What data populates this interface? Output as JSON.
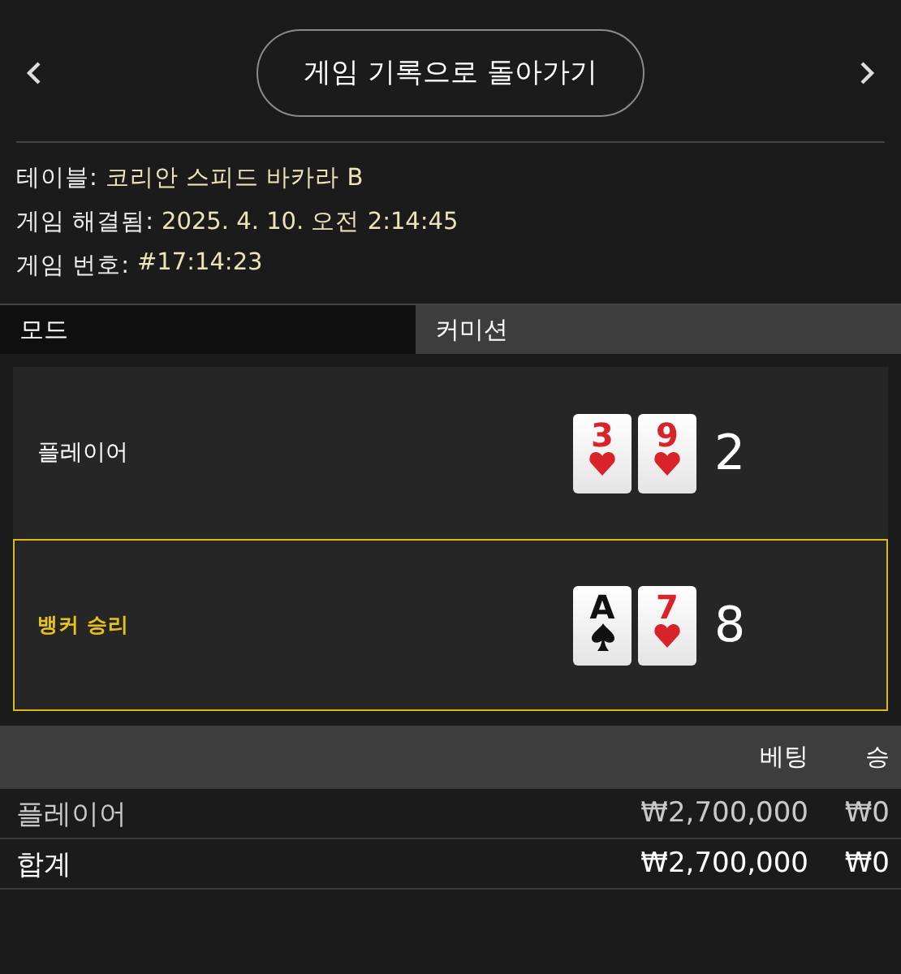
{
  "header": {
    "back_button": "게임 기록으로 돌아가기"
  },
  "info": [
    {
      "label": "테이블:",
      "value": "코리안 스피드 바카라 B"
    },
    {
      "label": "게임 해결됨:",
      "value": "2025. 4. 10. 오전 2:14:45"
    },
    {
      "label": "게임 번호:",
      "value": "#17:14:23"
    }
  ],
  "mode_row": {
    "label": "모드",
    "value": "커미션"
  },
  "hands": [
    {
      "label": "플레이어",
      "winner": false,
      "cards": [
        {
          "rank": "3",
          "kind": "heart"
        },
        {
          "rank": "9",
          "kind": "heart"
        }
      ],
      "score": "2"
    },
    {
      "label": "뱅커 승리",
      "winner": true,
      "cards": [
        {
          "rank": "A",
          "kind": "spade"
        },
        {
          "rank": "7",
          "kind": "heart"
        }
      ],
      "score": "8"
    }
  ],
  "bets_table": {
    "columns": [
      "베팅",
      "승"
    ],
    "rows": [
      {
        "label": "플레이어",
        "bet": "₩2,700,000",
        "win": "₩0"
      }
    ],
    "total": {
      "label": "합계",
      "bet": "₩2,700,000",
      "win": "₩0"
    }
  }
}
